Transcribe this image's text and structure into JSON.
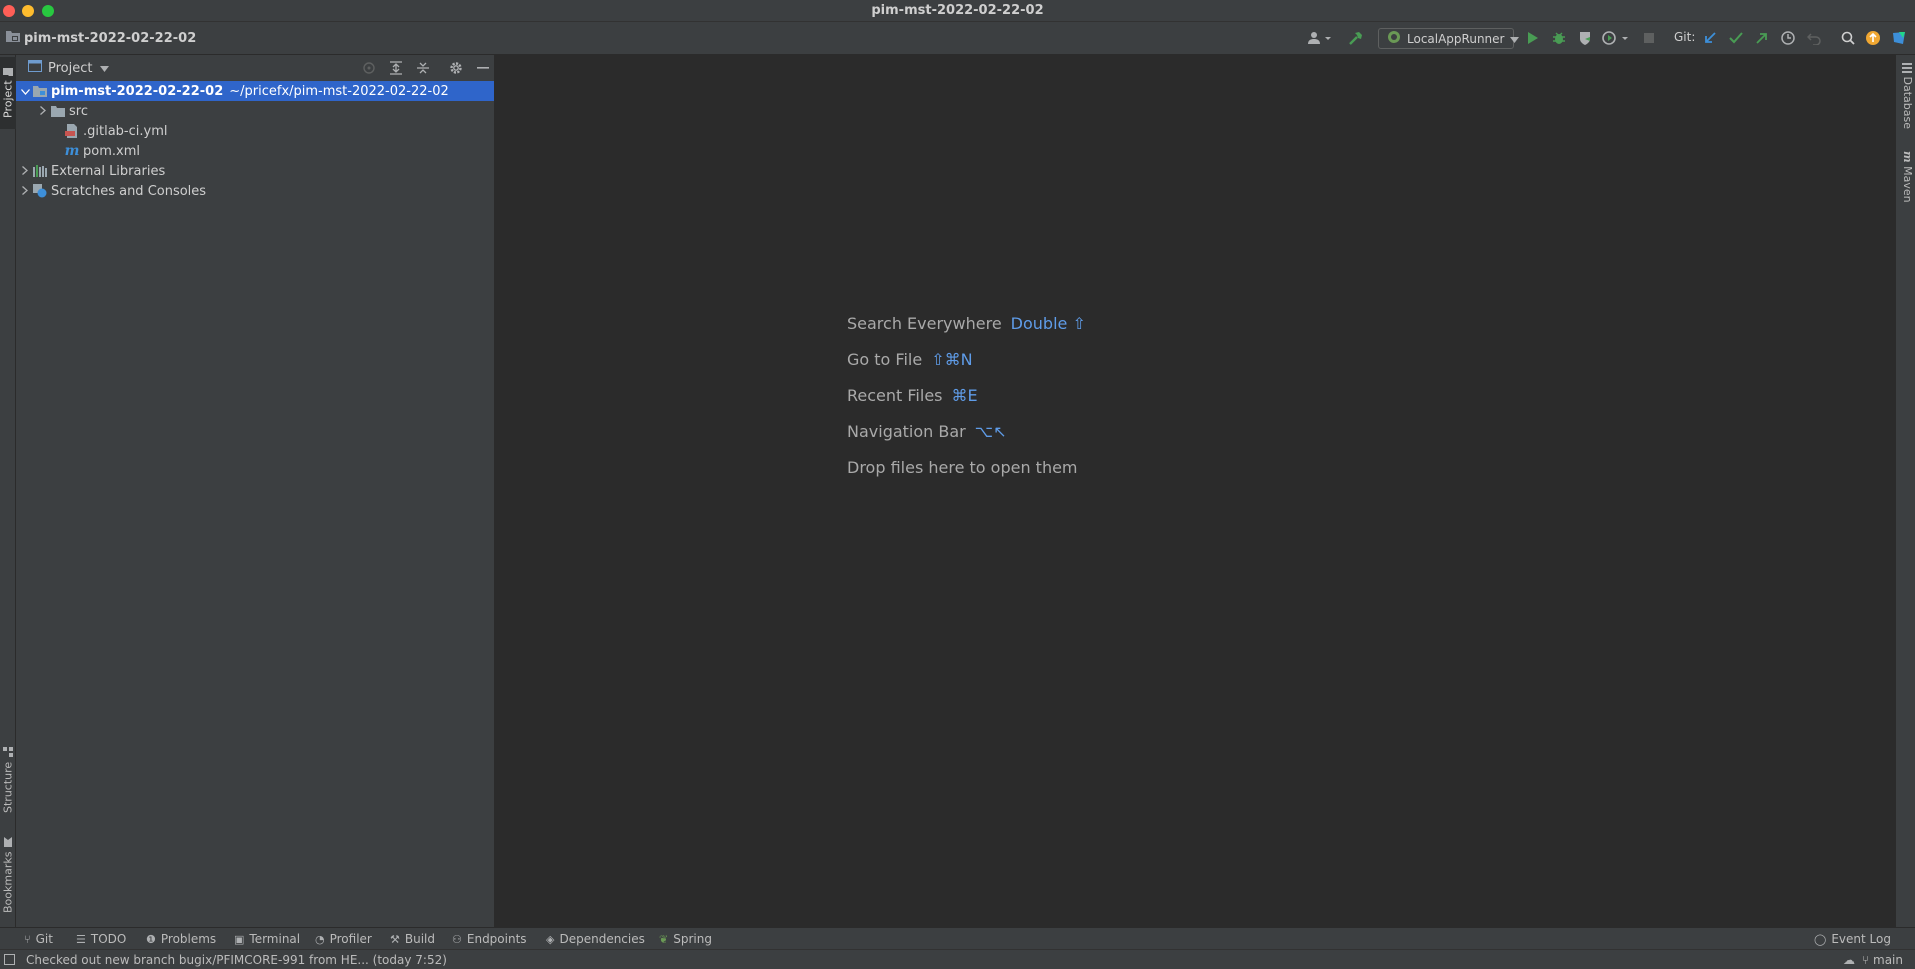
{
  "window": {
    "title": "pim-mst-2022-02-22-02"
  },
  "toolbar": {
    "project_name": "pim-mst-2022-02-22-02",
    "run_config": "LocalAppRunner",
    "git_label": "Git:"
  },
  "left_strip": {
    "tabs": [
      "Project",
      "Structure",
      "Bookmarks"
    ]
  },
  "right_strip": {
    "tabs": [
      "Database",
      "Maven"
    ]
  },
  "project_panel": {
    "title": "Project",
    "tree": [
      {
        "label": "pim-mst-2022-02-22-02",
        "hint": "~/pricefx/pim-mst-2022-02-22-02",
        "selected": true,
        "expanded": true,
        "icon": "module-folder-icon"
      },
      {
        "label": "src",
        "icon": "folder-icon",
        "expandable": true
      },
      {
        "label": ".gitlab-ci.yml",
        "icon": "yaml-file-icon"
      },
      {
        "label": "pom.xml",
        "icon": "maven-file-icon"
      },
      {
        "label": "External Libraries",
        "icon": "libraries-icon",
        "expandable": true
      },
      {
        "label": "Scratches and Consoles",
        "icon": "scratches-icon",
        "expandable": true
      }
    ]
  },
  "editor": {
    "hints": [
      {
        "label": "Search Everywhere",
        "key": "Double ⇧"
      },
      {
        "label": "Go to File",
        "key": "⇧⌘N"
      },
      {
        "label": "Recent Files",
        "key": "⌘E"
      },
      {
        "label": "Navigation Bar",
        "key": "⌥↖"
      },
      {
        "label": "Drop files here to open them",
        "key": ""
      }
    ]
  },
  "bottom_bar": {
    "tabs": [
      "Git",
      "TODO",
      "Problems",
      "Terminal",
      "Profiler",
      "Build",
      "Endpoints",
      "Dependencies",
      "Spring"
    ],
    "event_log": "Event Log"
  },
  "status_bar": {
    "message": "Checked out new branch bugix/PFIMCORE-991 from HE... (today 7:52)",
    "branch": "main"
  },
  "colors": {
    "selection": "#2f65ca",
    "accent_key": "#5f9ce8",
    "run_green": "#499c54"
  }
}
